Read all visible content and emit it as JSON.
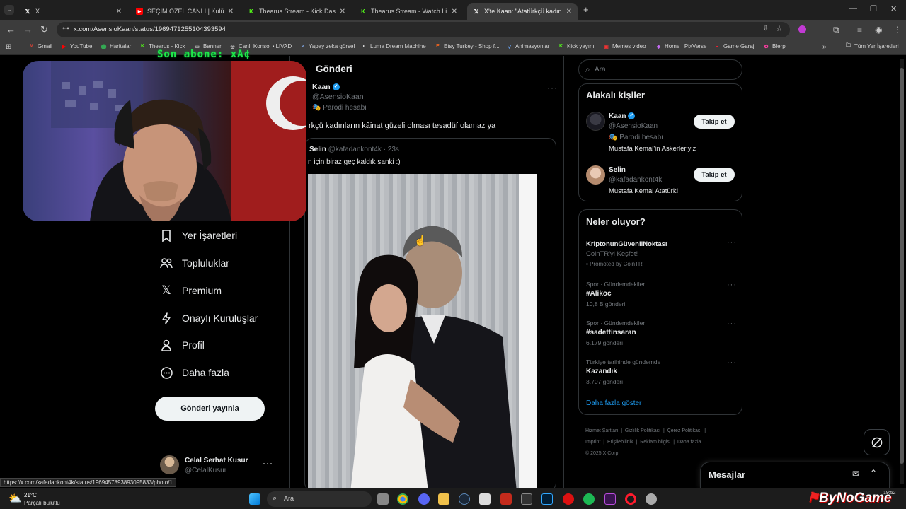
{
  "browser": {
    "tabs": [
      {
        "title": "X",
        "favicon": "x-logo",
        "active": false
      },
      {
        "title": "SEÇİM ÖZEL CANLI | Kulübü",
        "favicon": "youtube-icon",
        "active": false
      },
      {
        "title": "Thearus Stream - Kick Dashboa",
        "favicon": "kick-icon",
        "active": false
      },
      {
        "title": "Thearus Stream - Watch Live o",
        "favicon": "kick-icon",
        "active": false
      },
      {
        "title": "X'te Kaan: \"Atatürkçü kadınların",
        "favicon": "x-logo",
        "active": true
      }
    ],
    "url": "x.com/AsensioKaan/status/1969471255104393594",
    "bookmarks": [
      "Gmail",
      "YouTube",
      "Haritalar",
      "Thearus - Kick",
      "Banner",
      "Canlı Konsol • LIVAD",
      "Yapay zeka görsel",
      "Luma Dream Machine",
      "Etsy Turkey - Shop f...",
      "Animasyonlar",
      "Kick yayını",
      "Memes video",
      "Home | PixVerse",
      "Game Garaj",
      "Blerp"
    ],
    "bookmarks_all": "Tüm Yer İşaretleri",
    "status_url": "https://x.com/kafadankont4k/status/1969457893893095833/photo/1"
  },
  "overlay": {
    "banner_text": "Son abone: xA¢"
  },
  "left_nav": {
    "items": [
      {
        "label": "Yer İşaretleri",
        "icon": "bookmark-icon"
      },
      {
        "label": "Topluluklar",
        "icon": "communities-icon"
      },
      {
        "label": "Premium",
        "icon": "x-premium-icon"
      },
      {
        "label": "Onaylı Kuruluşlar",
        "icon": "lightning-icon"
      },
      {
        "label": "Profil",
        "icon": "profile-icon"
      },
      {
        "label": "Daha fazla",
        "icon": "more-circle-icon"
      }
    ],
    "post_button": "Gönderi yayınla",
    "account": {
      "name": "Celal Serhat Kusur",
      "handle": "@CelalKusur"
    }
  },
  "post": {
    "header": "Gönderi",
    "author_name": "Kaan",
    "author_handle": "@AsensioKaan",
    "parody_label": "Parodi hesabı",
    "text": "rkçü kadınların kâinat güzeli olması tesadüf olamaz ya",
    "quote": {
      "author_name": "Selin",
      "author_handle": "@kafadankont4k · 23s",
      "text": "n için biraz geç kaldık sanki :)"
    }
  },
  "right": {
    "search_placeholder": "Ara",
    "related_title": "Alakalı kişiler",
    "related": [
      {
        "name": "Kaan",
        "handle": "@AsensioKaan",
        "parody": "Parodi hesabı",
        "bio": "Mustafa Kemal'in Askerleriyiz",
        "button": "Takip et"
      },
      {
        "name": "Selin",
        "handle": "@kafadankont4k",
        "bio": "Mustafa Kemal Atatürk!",
        "button": "Takip et"
      }
    ],
    "trends_title": "Neler oluyor?",
    "trends": [
      {
        "context": "",
        "title": "KriptonunGüvenliNoktası",
        "sub": "CoinTR'yi Keşfet!",
        "promo": "Promoted by CoinTR"
      },
      {
        "context": "Spor · Gündemdekiler",
        "title": "#Alikoc",
        "sub": "10,8 B gönderi"
      },
      {
        "context": "Spor · Gündemdekiler",
        "title": "#sadettinsaran",
        "sub": "6.179 gönderi"
      },
      {
        "context": "Türkiye tarihinde gündemde",
        "title": "Kazandık",
        "sub": "3.707 gönderi"
      }
    ],
    "show_more": "Daha fazla göster",
    "footer_links": [
      "Hizmet Şartları",
      "|",
      "Gizlilik Politikası",
      "|",
      "Çerez Politikası",
      "|",
      "Imprint",
      "|",
      "Erişilebilirlik",
      "|",
      "Reklam bilgisi",
      "|",
      "Daha fazla ...",
      "© 2025 X Corp."
    ],
    "messages_label": "Mesajlar"
  },
  "taskbar": {
    "weather_temp": "21°C",
    "weather_desc": "Parçalı bulutlu",
    "search_placeholder": "Ara",
    "clock": "19:52",
    "watermark": "ByNoGame"
  },
  "colors": {
    "accent": "#1d9bf0",
    "kick": "#53fc18",
    "banner_green": "#1fe84a"
  }
}
